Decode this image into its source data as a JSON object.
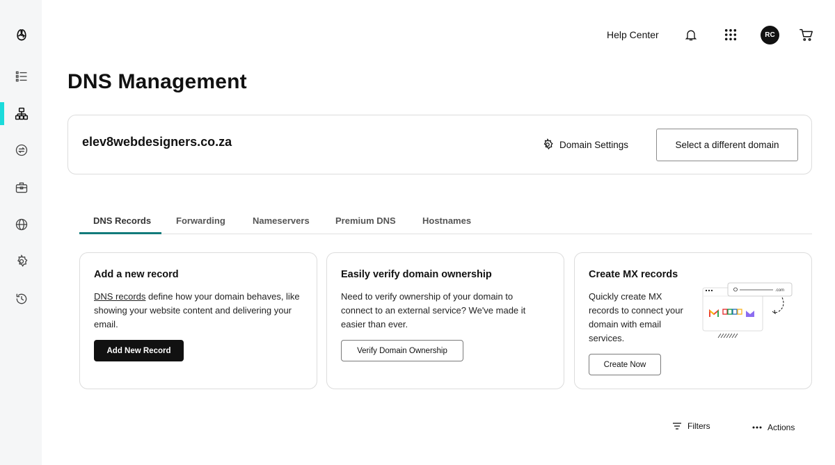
{
  "topbar": {
    "help_label": "Help Center",
    "avatar_initials": "RC"
  },
  "page": {
    "title": "DNS Management"
  },
  "domain": {
    "name": "elev8webdesigners.co.za",
    "settings_label": "Domain Settings",
    "select_label": "Select a different domain"
  },
  "tabs": [
    {
      "label": "DNS Records",
      "active": true
    },
    {
      "label": "Forwarding",
      "active": false
    },
    {
      "label": "Nameservers",
      "active": false
    },
    {
      "label": "Premium DNS",
      "active": false
    },
    {
      "label": "Hostnames",
      "active": false
    }
  ],
  "cards": {
    "add_record": {
      "title": "Add a new record",
      "link_text": "DNS records",
      "body": " define how your domain behaves, like showing your website content and delivering your email.",
      "button": "Add New Record"
    },
    "verify": {
      "title": "Easily verify domain ownership",
      "body": "Need to verify ownership of your domain to connect to an external service? We've made it easier than ever.",
      "button": "Verify Domain Ownership"
    },
    "mx": {
      "title": "Create MX records",
      "body": "Quickly create MX records to connect your domain with email services.",
      "button": "Create Now",
      "illustration_domain_text": ".com"
    }
  },
  "toolbar": {
    "filters_label": "Filters",
    "actions_label": "Actions"
  },
  "colors": {
    "accent": "#1bdbdb",
    "tab_underline": "#117b7b",
    "sidebar_bg": "#f5f6f7",
    "button_dark": "#111111"
  },
  "sidebar": {
    "items": [
      {
        "icon": "godaddy-logo-icon"
      },
      {
        "icon": "list-icon"
      },
      {
        "icon": "sitemap-icon",
        "active": true
      },
      {
        "icon": "transfer-icon"
      },
      {
        "icon": "briefcase-icon"
      },
      {
        "icon": "globe-icon"
      },
      {
        "icon": "settings-icon"
      },
      {
        "icon": "history-icon"
      }
    ]
  }
}
